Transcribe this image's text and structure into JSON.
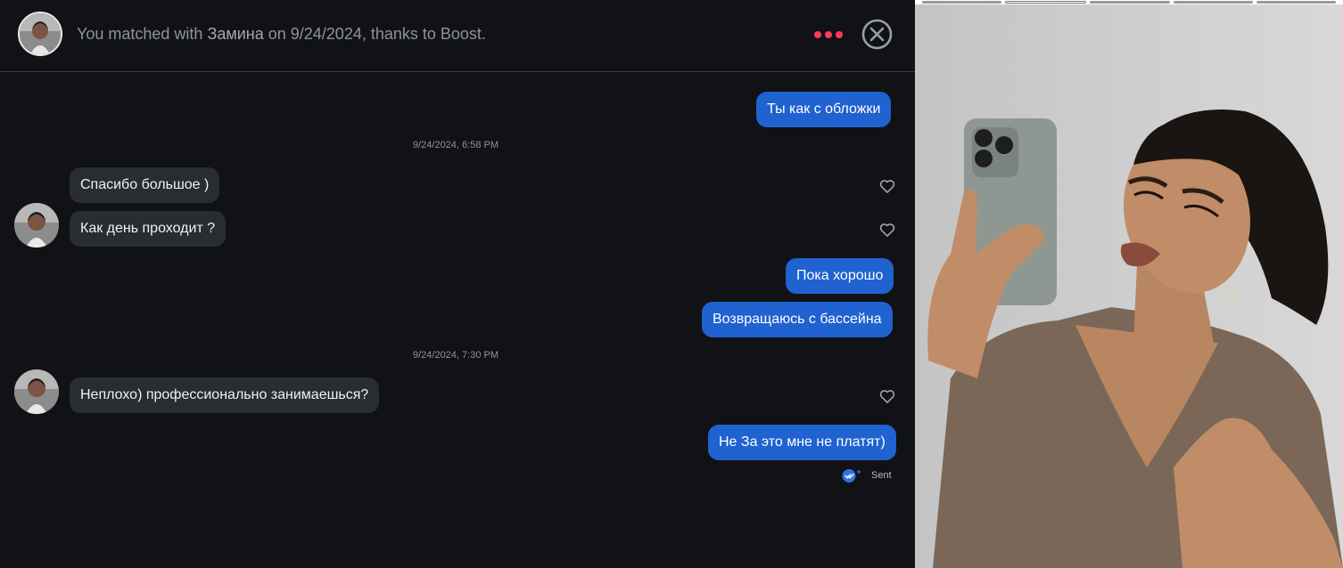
{
  "header": {
    "match_prefix": "You matched with",
    "match_name": "Замина",
    "match_suffix": "on 9/24/2024, thanks to Boost."
  },
  "icons": {
    "options": "more-options-icon",
    "close": "close-circle-icon",
    "like": "heart-outline-icon",
    "sent": "double-check-icon"
  },
  "colors": {
    "accent_red": "#fd3a56",
    "outgoing_bubble": "#1f62d0",
    "incoming_bubble": "#2a2c33",
    "background": "#111216"
  },
  "messages": {
    "m1": "Ты как с обложки",
    "ts1": "9/24/2024, 6:58 PM",
    "m2": "Спасибо большое )",
    "m3": "Как день проходит ?",
    "m4": "Пока хорошо",
    "m5": "Возвращаюсь с бассейна",
    "ts2": "9/24/2024, 7:30 PM",
    "m6": "Неплохо) профессионально занимаешься?",
    "m7": "Не За это мне не платят)",
    "status": "Sent"
  },
  "profile": {
    "photo_count": 5,
    "current_photo": 2
  }
}
